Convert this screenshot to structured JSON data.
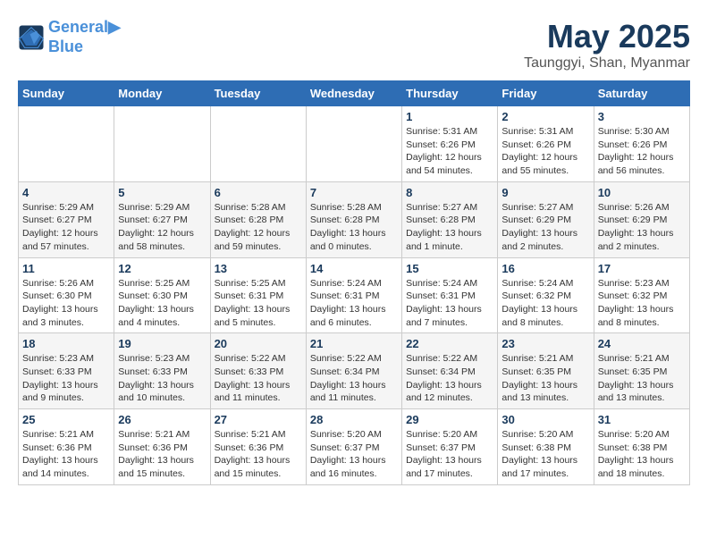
{
  "header": {
    "logo_line1": "General",
    "logo_line2": "Blue",
    "month_title": "May 2025",
    "subtitle": "Taunggyi, Shan, Myanmar"
  },
  "days_of_week": [
    "Sunday",
    "Monday",
    "Tuesday",
    "Wednesday",
    "Thursday",
    "Friday",
    "Saturday"
  ],
  "weeks": [
    [
      {
        "day": "",
        "info": ""
      },
      {
        "day": "",
        "info": ""
      },
      {
        "day": "",
        "info": ""
      },
      {
        "day": "",
        "info": ""
      },
      {
        "day": "1",
        "info": "Sunrise: 5:31 AM\nSunset: 6:26 PM\nDaylight: 12 hours\nand 54 minutes."
      },
      {
        "day": "2",
        "info": "Sunrise: 5:31 AM\nSunset: 6:26 PM\nDaylight: 12 hours\nand 55 minutes."
      },
      {
        "day": "3",
        "info": "Sunrise: 5:30 AM\nSunset: 6:26 PM\nDaylight: 12 hours\nand 56 minutes."
      }
    ],
    [
      {
        "day": "4",
        "info": "Sunrise: 5:29 AM\nSunset: 6:27 PM\nDaylight: 12 hours\nand 57 minutes."
      },
      {
        "day": "5",
        "info": "Sunrise: 5:29 AM\nSunset: 6:27 PM\nDaylight: 12 hours\nand 58 minutes."
      },
      {
        "day": "6",
        "info": "Sunrise: 5:28 AM\nSunset: 6:28 PM\nDaylight: 12 hours\nand 59 minutes."
      },
      {
        "day": "7",
        "info": "Sunrise: 5:28 AM\nSunset: 6:28 PM\nDaylight: 13 hours\nand 0 minutes."
      },
      {
        "day": "8",
        "info": "Sunrise: 5:27 AM\nSunset: 6:28 PM\nDaylight: 13 hours\nand 1 minute."
      },
      {
        "day": "9",
        "info": "Sunrise: 5:27 AM\nSunset: 6:29 PM\nDaylight: 13 hours\nand 2 minutes."
      },
      {
        "day": "10",
        "info": "Sunrise: 5:26 AM\nSunset: 6:29 PM\nDaylight: 13 hours\nand 2 minutes."
      }
    ],
    [
      {
        "day": "11",
        "info": "Sunrise: 5:26 AM\nSunset: 6:30 PM\nDaylight: 13 hours\nand 3 minutes."
      },
      {
        "day": "12",
        "info": "Sunrise: 5:25 AM\nSunset: 6:30 PM\nDaylight: 13 hours\nand 4 minutes."
      },
      {
        "day": "13",
        "info": "Sunrise: 5:25 AM\nSunset: 6:31 PM\nDaylight: 13 hours\nand 5 minutes."
      },
      {
        "day": "14",
        "info": "Sunrise: 5:24 AM\nSunset: 6:31 PM\nDaylight: 13 hours\nand 6 minutes."
      },
      {
        "day": "15",
        "info": "Sunrise: 5:24 AM\nSunset: 6:31 PM\nDaylight: 13 hours\nand 7 minutes."
      },
      {
        "day": "16",
        "info": "Sunrise: 5:24 AM\nSunset: 6:32 PM\nDaylight: 13 hours\nand 8 minutes."
      },
      {
        "day": "17",
        "info": "Sunrise: 5:23 AM\nSunset: 6:32 PM\nDaylight: 13 hours\nand 8 minutes."
      }
    ],
    [
      {
        "day": "18",
        "info": "Sunrise: 5:23 AM\nSunset: 6:33 PM\nDaylight: 13 hours\nand 9 minutes."
      },
      {
        "day": "19",
        "info": "Sunrise: 5:23 AM\nSunset: 6:33 PM\nDaylight: 13 hours\nand 10 minutes."
      },
      {
        "day": "20",
        "info": "Sunrise: 5:22 AM\nSunset: 6:33 PM\nDaylight: 13 hours\nand 11 minutes."
      },
      {
        "day": "21",
        "info": "Sunrise: 5:22 AM\nSunset: 6:34 PM\nDaylight: 13 hours\nand 11 minutes."
      },
      {
        "day": "22",
        "info": "Sunrise: 5:22 AM\nSunset: 6:34 PM\nDaylight: 13 hours\nand 12 minutes."
      },
      {
        "day": "23",
        "info": "Sunrise: 5:21 AM\nSunset: 6:35 PM\nDaylight: 13 hours\nand 13 minutes."
      },
      {
        "day": "24",
        "info": "Sunrise: 5:21 AM\nSunset: 6:35 PM\nDaylight: 13 hours\nand 13 minutes."
      }
    ],
    [
      {
        "day": "25",
        "info": "Sunrise: 5:21 AM\nSunset: 6:36 PM\nDaylight: 13 hours\nand 14 minutes."
      },
      {
        "day": "26",
        "info": "Sunrise: 5:21 AM\nSunset: 6:36 PM\nDaylight: 13 hours\nand 15 minutes."
      },
      {
        "day": "27",
        "info": "Sunrise: 5:21 AM\nSunset: 6:36 PM\nDaylight: 13 hours\nand 15 minutes."
      },
      {
        "day": "28",
        "info": "Sunrise: 5:20 AM\nSunset: 6:37 PM\nDaylight: 13 hours\nand 16 minutes."
      },
      {
        "day": "29",
        "info": "Sunrise: 5:20 AM\nSunset: 6:37 PM\nDaylight: 13 hours\nand 17 minutes."
      },
      {
        "day": "30",
        "info": "Sunrise: 5:20 AM\nSunset: 6:38 PM\nDaylight: 13 hours\nand 17 minutes."
      },
      {
        "day": "31",
        "info": "Sunrise: 5:20 AM\nSunset: 6:38 PM\nDaylight: 13 hours\nand 18 minutes."
      }
    ]
  ]
}
